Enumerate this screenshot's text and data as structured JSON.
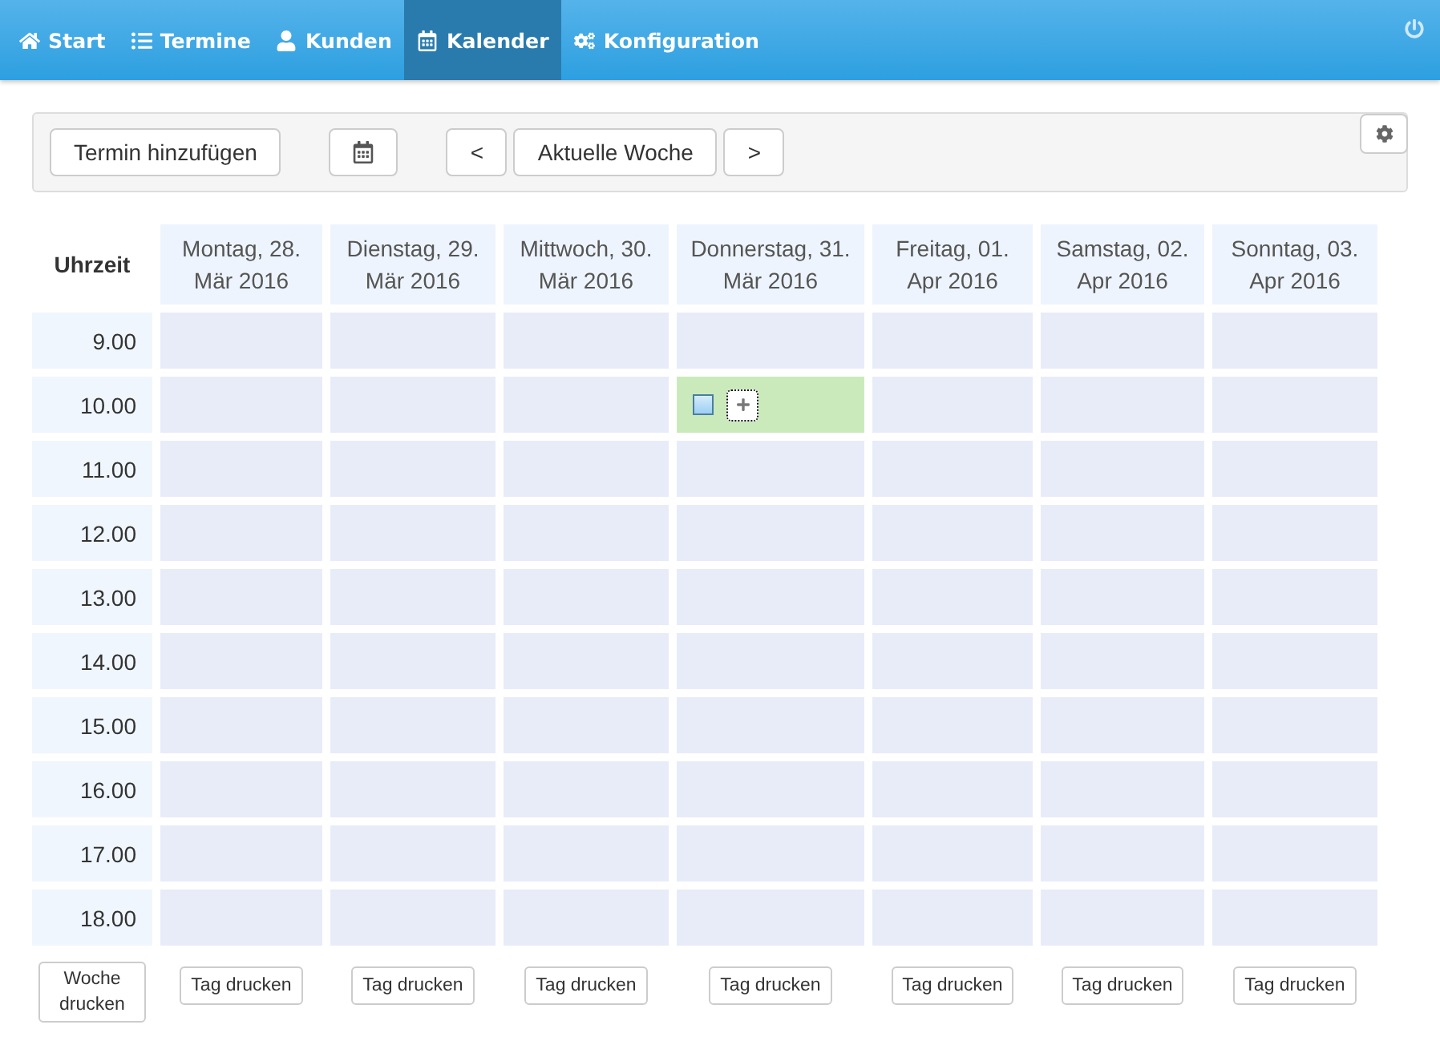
{
  "nav": {
    "items": [
      {
        "label": "Start",
        "kind": "home",
        "selected": false
      },
      {
        "label": "Termine",
        "kind": "list",
        "selected": false
      },
      {
        "label": "Kunden",
        "kind": "user",
        "selected": false
      },
      {
        "label": "Kalender",
        "kind": "calendar",
        "selected": true
      },
      {
        "label": "Konfiguration",
        "kind": "cogs",
        "selected": false
      }
    ]
  },
  "toolbar": {
    "add_button": "Termin hinzufügen",
    "prev_button": "<",
    "current_week_button": "Aktuelle Woche",
    "next_button": ">"
  },
  "calendar": {
    "time_header": "Uhrzeit",
    "days": [
      {
        "title": "Montag, 28.",
        "date": "Mär 2016",
        "print": "Tag drucken"
      },
      {
        "title": "Dienstag, 29.",
        "date": "Mär 2016",
        "print": "Tag drucken"
      },
      {
        "title": "Mittwoch, 30.",
        "date": "Mär 2016",
        "print": "Tag drucken"
      },
      {
        "title": "Donnerstag, 31.",
        "date": "Mär 2016",
        "print": "Tag drucken"
      },
      {
        "title": "Freitag, 01.",
        "date": "Apr 2016",
        "print": "Tag drucken"
      },
      {
        "title": "Samstag, 02.",
        "date": "Apr 2016",
        "print": "Tag drucken"
      },
      {
        "title": "Sonntag, 03.",
        "date": "Apr 2016",
        "print": "Tag drucken"
      }
    ],
    "rows": [
      {
        "time": "9.00",
        "cells": [
          {
            "kind": "empty"
          },
          {
            "kind": "empty"
          },
          {
            "kind": "empty"
          },
          {
            "kind": "empty"
          },
          {
            "kind": "empty"
          },
          {
            "kind": "empty"
          },
          {
            "kind": "empty"
          }
        ]
      },
      {
        "time": "10.00",
        "cells": [
          {
            "kind": "empty"
          },
          {
            "kind": "empty"
          },
          {
            "kind": "empty"
          },
          {
            "kind": "event",
            "checked": false
          },
          {
            "kind": "empty"
          },
          {
            "kind": "empty"
          },
          {
            "kind": "empty"
          }
        ]
      },
      {
        "time": "11.00",
        "cells": [
          {
            "kind": "empty"
          },
          {
            "kind": "empty"
          },
          {
            "kind": "empty"
          },
          {
            "kind": "empty"
          },
          {
            "kind": "empty"
          },
          {
            "kind": "empty"
          },
          {
            "kind": "empty"
          }
        ]
      },
      {
        "time": "12.00",
        "cells": [
          {
            "kind": "empty"
          },
          {
            "kind": "empty"
          },
          {
            "kind": "empty"
          },
          {
            "kind": "empty"
          },
          {
            "kind": "empty"
          },
          {
            "kind": "empty"
          },
          {
            "kind": "empty"
          }
        ]
      },
      {
        "time": "13.00",
        "cells": [
          {
            "kind": "empty"
          },
          {
            "kind": "empty"
          },
          {
            "kind": "empty"
          },
          {
            "kind": "empty"
          },
          {
            "kind": "empty"
          },
          {
            "kind": "empty"
          },
          {
            "kind": "empty"
          }
        ]
      },
      {
        "time": "14.00",
        "cells": [
          {
            "kind": "empty"
          },
          {
            "kind": "empty"
          },
          {
            "kind": "empty"
          },
          {
            "kind": "empty"
          },
          {
            "kind": "empty"
          },
          {
            "kind": "empty"
          },
          {
            "kind": "empty"
          }
        ]
      },
      {
        "time": "15.00",
        "cells": [
          {
            "kind": "empty"
          },
          {
            "kind": "empty"
          },
          {
            "kind": "empty"
          },
          {
            "kind": "empty"
          },
          {
            "kind": "empty"
          },
          {
            "kind": "empty"
          },
          {
            "kind": "empty"
          }
        ]
      },
      {
        "time": "16.00",
        "cells": [
          {
            "kind": "empty"
          },
          {
            "kind": "empty"
          },
          {
            "kind": "empty"
          },
          {
            "kind": "empty"
          },
          {
            "kind": "empty"
          },
          {
            "kind": "empty"
          },
          {
            "kind": "empty"
          }
        ]
      },
      {
        "time": "17.00",
        "cells": [
          {
            "kind": "empty"
          },
          {
            "kind": "empty"
          },
          {
            "kind": "empty"
          },
          {
            "kind": "empty"
          },
          {
            "kind": "empty"
          },
          {
            "kind": "empty"
          },
          {
            "kind": "empty"
          }
        ]
      },
      {
        "time": "18.00",
        "cells": [
          {
            "kind": "empty"
          },
          {
            "kind": "empty"
          },
          {
            "kind": "empty"
          },
          {
            "kind": "empty"
          },
          {
            "kind": "empty"
          },
          {
            "kind": "empty"
          },
          {
            "kind": "empty"
          }
        ]
      }
    ],
    "week_print": "Woche drucken"
  }
}
